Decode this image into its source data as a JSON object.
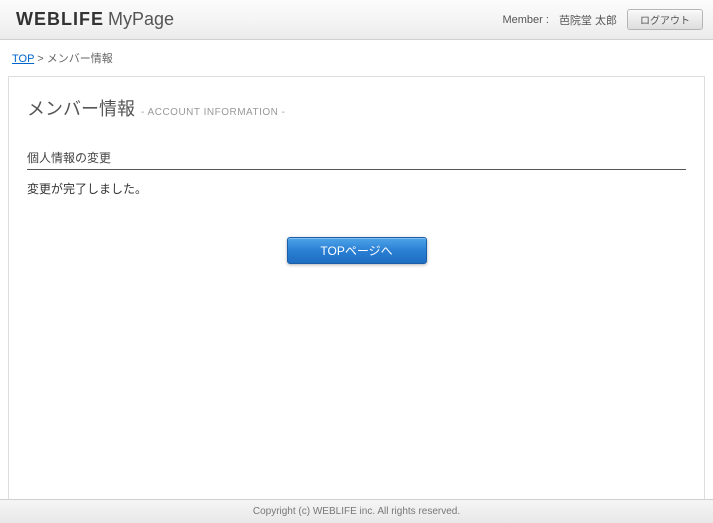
{
  "header": {
    "logo_bold": "WEBLIFE",
    "logo_light": "MyPage",
    "member_label": "Member :",
    "member_name": "芭院堂 太郎",
    "logout_label": "ログアウト"
  },
  "breadcrumb": {
    "top_link": "TOP",
    "separator": ">",
    "current": "メンバー情報"
  },
  "page": {
    "title_main": "メンバー情報",
    "title_sub": "- ACCOUNT INFORMATION -",
    "section_title": "個人情報の変更",
    "message": "変更が完了しました。",
    "top_button": "TOPページへ"
  },
  "footer": {
    "copyright": "Copyright (c) WEBLIFE inc. All rights reserved."
  }
}
